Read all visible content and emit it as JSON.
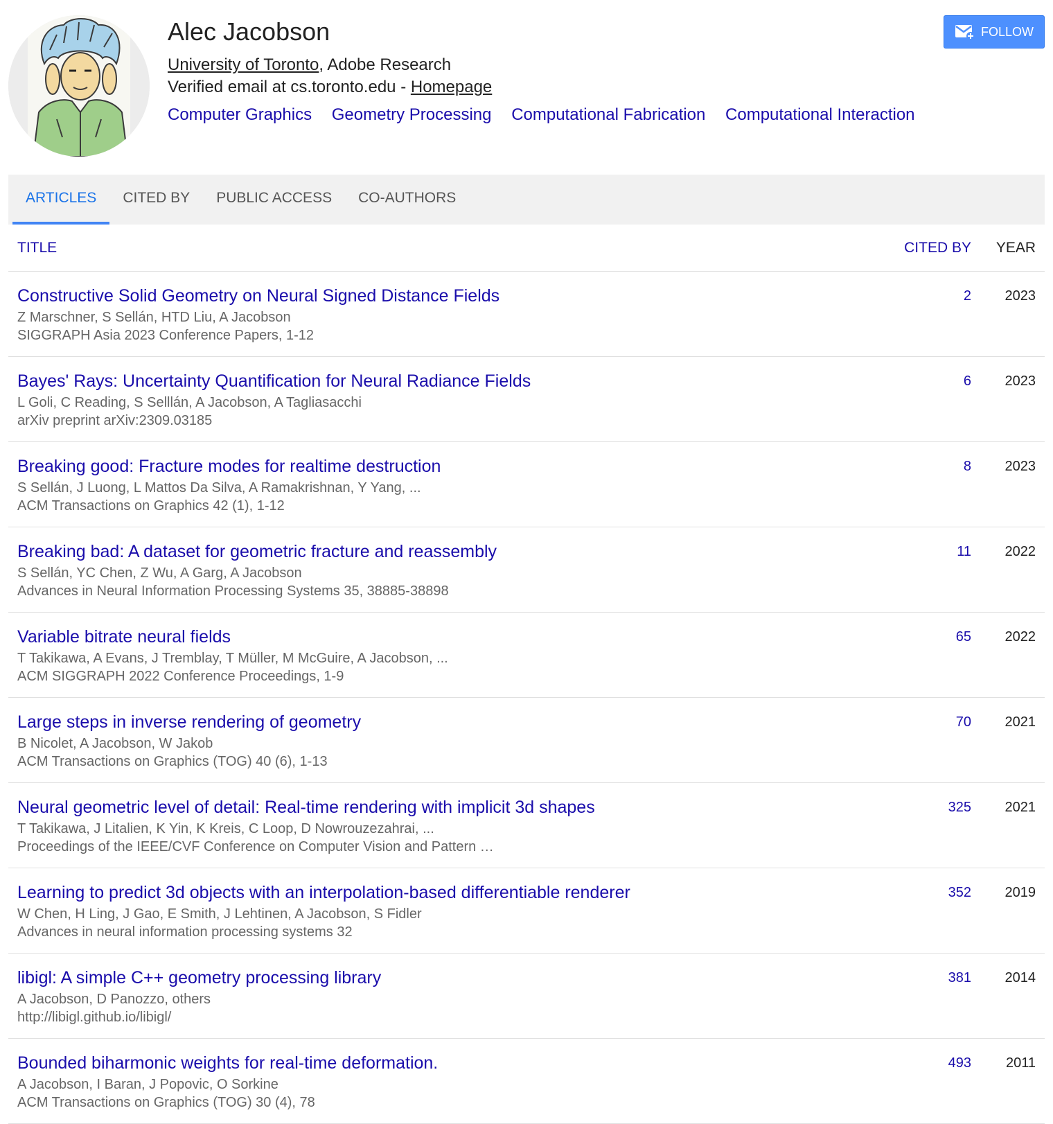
{
  "profile": {
    "name": "Alec Jacobson",
    "affiliation_link": "University of Toronto",
    "affiliation_rest": ", Adobe Research",
    "email_text": "Verified email at cs.toronto.edu - ",
    "homepage_label": "Homepage",
    "interests": [
      "Computer Graphics",
      "Geometry Processing",
      "Computational Fabrication",
      "Computational Interaction"
    ],
    "avatar_icon": "portrait-sketch"
  },
  "follow": {
    "label": "FOLLOW",
    "icon": "mail-plus-icon",
    "color": "#4d90fe"
  },
  "tabs": [
    "ARTICLES",
    "CITED BY",
    "PUBLIC ACCESS",
    "CO-AUTHORS"
  ],
  "table": {
    "col_title": "TITLE",
    "col_cited": "CITED BY",
    "col_year": "YEAR",
    "rows": [
      {
        "title": "Constructive Solid Geometry on Neural Signed Distance Fields",
        "authors": "Z Marschner, S Sellán, HTD Liu, A Jacobson",
        "venue": "SIGGRAPH Asia 2023 Conference Papers, 1-12",
        "cited": "2",
        "year": "2023"
      },
      {
        "title": "Bayes' Rays: Uncertainty Quantification for Neural Radiance Fields",
        "authors": "L Goli, C Reading, S Selllán, A Jacobson, A Tagliasacchi",
        "venue": "arXiv preprint arXiv:2309.03185",
        "cited": "6",
        "year": "2023"
      },
      {
        "title": "Breaking good: Fracture modes for realtime destruction",
        "authors": "S Sellán, J Luong, L Mattos Da Silva, A Ramakrishnan, Y Yang, ...",
        "venue": "ACM Transactions on Graphics 42 (1), 1-12",
        "cited": "8",
        "year": "2023"
      },
      {
        "title": "Breaking bad: A dataset for geometric fracture and reassembly",
        "authors": "S Sellán, YC Chen, Z Wu, A Garg, A Jacobson",
        "venue": "Advances in Neural Information Processing Systems 35, 38885-38898",
        "cited": "11",
        "year": "2022"
      },
      {
        "title": "Variable bitrate neural fields",
        "authors": "T Takikawa, A Evans, J Tremblay, T Müller, M McGuire, A Jacobson, ...",
        "venue": "ACM SIGGRAPH 2022 Conference Proceedings, 1-9",
        "cited": "65",
        "year": "2022"
      },
      {
        "title": "Large steps in inverse rendering of geometry",
        "authors": "B Nicolet, A Jacobson, W Jakob",
        "venue": "ACM Transactions on Graphics (TOG) 40 (6), 1-13",
        "cited": "70",
        "year": "2021"
      },
      {
        "title": "Neural geometric level of detail: Real-time rendering with implicit 3d shapes",
        "authors": "T Takikawa, J Litalien, K Yin, K Kreis, C Loop, D Nowrouzezahrai, ...",
        "venue": "Proceedings of the IEEE/CVF Conference on Computer Vision and Pattern …",
        "cited": "325",
        "year": "2021"
      },
      {
        "title": "Learning to predict 3d objects with an interpolation-based differentiable renderer",
        "authors": "W Chen, H Ling, J Gao, E Smith, J Lehtinen, A Jacobson, S Fidler",
        "venue": "Advances in neural information processing systems 32",
        "cited": "352",
        "year": "2019"
      },
      {
        "title": "libigl: A simple C++ geometry processing library",
        "authors": "A Jacobson, D Panozzo, others",
        "venue": "http://libigl.github.io/libigl/",
        "cited": "381",
        "year": "2014"
      },
      {
        "title": "Bounded biharmonic weights for real-time deformation.",
        "authors": "A Jacobson, I Baran, J Popovic, O Sorkine",
        "venue": "ACM Transactions on Graphics (TOG) 30 (4), 78",
        "cited": "493",
        "year": "2011"
      }
    ]
  }
}
